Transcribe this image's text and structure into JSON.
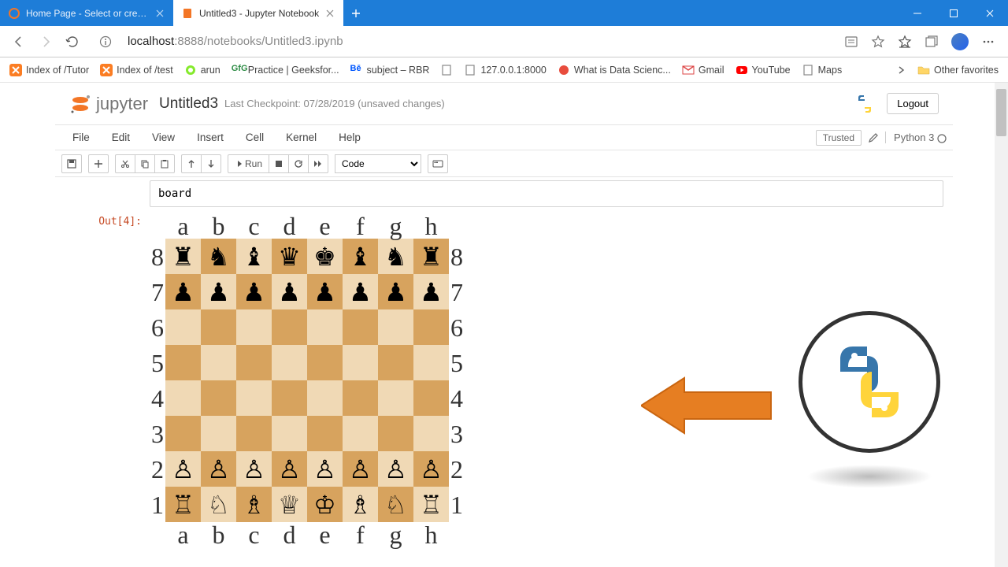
{
  "browser": {
    "tabs": [
      {
        "title": "Home Page - Select or create a n",
        "active": false
      },
      {
        "title": "Untitled3 - Jupyter Notebook",
        "active": true
      }
    ],
    "url_host": "localhost",
    "url_port": ":8888",
    "url_path": "/notebooks/Untitled3.ipynb"
  },
  "bookmarks": {
    "items": [
      {
        "label": "Index of /Tutor",
        "icon": "xampp"
      },
      {
        "label": "Index of /test",
        "icon": "xampp"
      },
      {
        "label": "arun",
        "icon": "swagger"
      },
      {
        "label": "Practice | Geeksfor...",
        "icon": "gfg"
      },
      {
        "label": "subject – RBR",
        "icon": "be"
      },
      {
        "label": "",
        "icon": "doc"
      },
      {
        "label": "127.0.0.1:8000",
        "icon": "doc"
      },
      {
        "label": "What is Data Scienc...",
        "icon": "ds"
      },
      {
        "label": "Gmail",
        "icon": "gmail"
      },
      {
        "label": "YouTube",
        "icon": "yt"
      },
      {
        "label": "Maps",
        "icon": "maps"
      }
    ],
    "other": "Other favorites"
  },
  "jupyter": {
    "logo_text": "jupyter",
    "notebook_name": "Untitled3",
    "checkpoint": "Last Checkpoint: 07/28/2019  (unsaved changes)",
    "logout": "Logout",
    "menus": [
      "File",
      "Edit",
      "View",
      "Insert",
      "Cell",
      "Kernel",
      "Help"
    ],
    "trusted": "Trusted",
    "kernel": "Python 3",
    "toolbar": {
      "run": "Run",
      "celltype": "Code"
    }
  },
  "cell": {
    "input": "board",
    "out_prompt": "Out[4]:"
  },
  "chess": {
    "files": [
      "a",
      "b",
      "c",
      "d",
      "e",
      "f",
      "g",
      "h"
    ],
    "ranks": [
      "8",
      "7",
      "6",
      "5",
      "4",
      "3",
      "2",
      "1"
    ],
    "pieces": {
      "r8": [
        "♜",
        "♞",
        "♝",
        "♛",
        "♚",
        "♝",
        "♞",
        "♜"
      ],
      "r7": [
        "♟",
        "♟",
        "♟",
        "♟",
        "♟",
        "♟",
        "♟",
        "♟"
      ],
      "r6": [
        "",
        "",
        "",
        "",
        "",
        "",
        "",
        ""
      ],
      "r5": [
        "",
        "",
        "",
        "",
        "",
        "",
        "",
        ""
      ],
      "r4": [
        "",
        "",
        "",
        "",
        "",
        "",
        "",
        ""
      ],
      "r3": [
        "",
        "",
        "",
        "",
        "",
        "",
        "",
        ""
      ],
      "r2": [
        "♙",
        "♙",
        "♙",
        "♙",
        "♙",
        "♙",
        "♙",
        "♙"
      ],
      "r1": [
        "♖",
        "♘",
        "♗",
        "♕",
        "♔",
        "♗",
        "♘",
        "♖"
      ]
    }
  }
}
